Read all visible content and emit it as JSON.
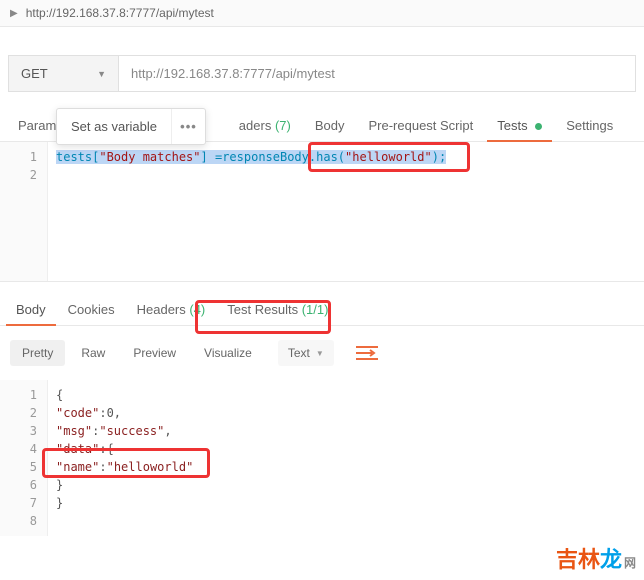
{
  "top_url": "http://192.168.37.8:7777/api/mytest",
  "request": {
    "method": "GET",
    "url": "http://192.168.37.8:7777/api/mytest"
  },
  "tabs": {
    "params": "Params",
    "auth_partial": "aders",
    "auth_count": "(7)",
    "body": "Body",
    "pre_request": "Pre-request Script",
    "tests": "Tests",
    "settings": "Settings"
  },
  "popover": {
    "set_as_variable": "Set as variable",
    "more": "•••"
  },
  "script": {
    "line1_a": "tests[",
    "line1_str1": "\"Body matches\"",
    "line1_b": "] =responseBody",
    "line1_c": ".has(",
    "line1_str2": "\"helloworld\"",
    "line1_d": ");"
  },
  "response_tabs": {
    "body": "Body",
    "cookies": "Cookies",
    "headers": "Headers",
    "headers_count": "(4)",
    "test_results": "Test Results",
    "test_results_ratio": "(1/1)"
  },
  "body_toolbar": {
    "pretty": "Pretty",
    "raw": "Raw",
    "preview": "Preview",
    "visualize": "Visualize",
    "type": "Text"
  },
  "json_body": {
    "l1": "{",
    "l2_k": "\"code\"",
    "l2_v": ":0,",
    "l3_k": "\"msg\"",
    "l3_v": ":",
    "l3_s": "\"success\"",
    "l3_e": ",",
    "l4_k": "\"data\"",
    "l4_v": ":{",
    "l5_k": "\"name\"",
    "l5_v": ":",
    "l5_s": "\"helloworld\"",
    "l6": "}",
    "l7": "}"
  },
  "watermark": {
    "a": "吉林",
    "b": "龙",
    "c": "网"
  }
}
